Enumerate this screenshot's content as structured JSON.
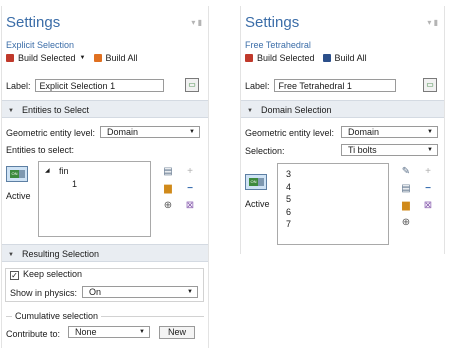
{
  "left": {
    "title": "Settings",
    "subtitle": "Explicit Selection",
    "build_selected": "Build Selected",
    "build_all": "Build All",
    "label_caption": "Label:",
    "label_value": "Explicit Selection 1",
    "section_entities": "Entities to Select",
    "geo_level_label": "Geometric entity level:",
    "geo_level_value": "Domain",
    "entities_label": "Entities to select:",
    "active_label": "Active",
    "tree_root": "fin",
    "tree_child": "1",
    "section_resulting": "Resulting Selection",
    "keep_selection": "Keep selection",
    "show_physics_label": "Show in physics:",
    "show_physics_value": "On",
    "cumulative_label": "Cumulative selection",
    "contribute_label": "Contribute to:",
    "contribute_value": "None",
    "new_button": "New"
  },
  "right": {
    "title": "Settings",
    "subtitle": "Free Tetrahedral",
    "build_selected": "Build Selected",
    "build_all": "Build All",
    "label_caption": "Label:",
    "label_value": "Free Tetrahedral 1",
    "section_domain": "Domain Selection",
    "geo_level_label": "Geometric entity level:",
    "geo_level_value": "Domain",
    "selection_label": "Selection:",
    "selection_value": "Ti bolts",
    "active_label": "Active",
    "domain_items": [
      "3",
      "4",
      "5",
      "6",
      "7"
    ]
  },
  "colors": {
    "accent": "#3b6da8",
    "section_bg": "#e9edf2",
    "build_selected_icon": "#c0392b",
    "build_all_left_icon": "#e07020",
    "build_all_right_icon": "#2b4f8a"
  },
  "icons": {
    "pin": "pin-icon",
    "list_actions": [
      "paste-icon",
      "add-icon",
      "copy-icon",
      "remove-icon",
      "zoom-selected-icon",
      "clear-selection-icon"
    ]
  }
}
